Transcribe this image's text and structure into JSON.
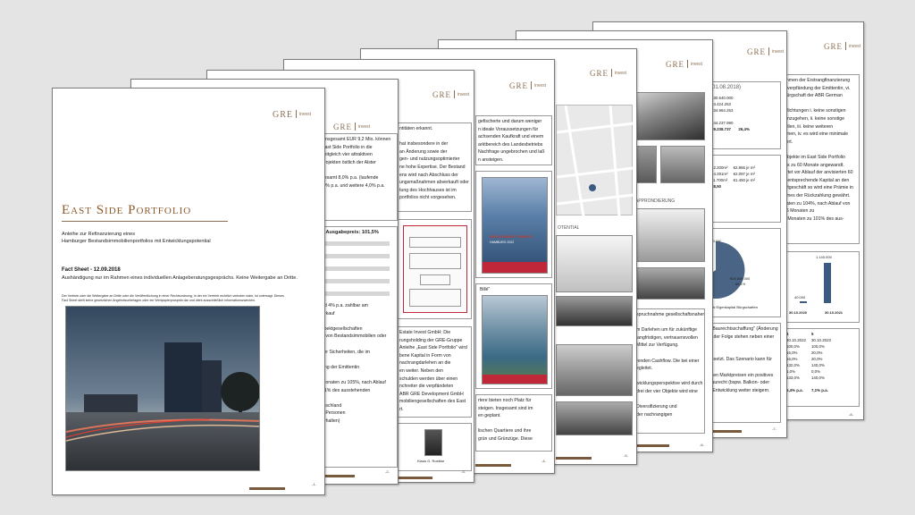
{
  "logo": {
    "brand": "GRE",
    "suffix": "invest"
  },
  "cover": {
    "title": "East Side Portfolio",
    "subtitle_1": "Anleihe zur Refinanzierung eines",
    "subtitle_2": "Hamburger Bestandsimmobilienportfolios mit Entwicklungspotential",
    "factsheet": "Fact Sheet - 12.09.2018",
    "notice": "Aushändigung nur im Rahmen eines individuellen Anlageberatungsgesprächs. Keine Weitergabe an Dritte.",
    "disclaimer_1": "Der Vertrieb oder die Weitergabe an Dritte oder die Veröffentlichung in einer Rechtsordnung, in der ein Vertrieb rechtlich verboten wäre, ist untersagt. Dieses",
    "disclaimer_2": "Fact Sheet stellt keine gesetzlichen Angebotsunterlagen oder ein Wertpapierprospekt dar und dient ausschließlich Informationszwecken.",
    "page_no": "-1-"
  },
  "page2": {
    "lines": [
      "t insgesamt EUR 9,2 Mio. können",
      "East Side Portfolio in die",
      "zeitgleich vier attraktiven",
      "projekten östlich der Alster",
      "",
      "gesamt 8,0% p.a. (laufende",
      ",0% p.a. und weitere 4,0% p.a."
    ],
    "heading": "l, Ausgabepreis: 101,5%",
    "lines2": [
      "nd 4% p.a. zahlbar am",
      "erkauf",
      "",
      "spektgesellschaften",
      "n von Bestandsimmobilien oder",
      "",
      "ller Sicherheiten, die im",
      "",
      "ung der Emittentin",
      "",
      "Monaten zu 105%, nach Ablauf",
      "01% des ausstehenden",
      "",
      "utschland",
      "h Personen",
      "erhalten)"
    ],
    "page_no": "-2-"
  },
  "page3": {
    "lines": [
      "ntitäten erkannt.",
      "",
      "hat insbesondere in der",
      "an Änderung sowie der",
      "gen- und nutzungsoptimierter",
      "ne hohe Expertise. Der Bestand",
      "ens wird nach Abschluss der",
      "ungsmaßnahmen abverkauft oder",
      "tung des Hochhauses ist im",
      "portfolios nicht vorgesehen."
    ],
    "lines2": [
      "Estate Invest GmbH: Die",
      "rungsholding der GRE-Gruppe",
      "Anleihe „East Side Portfolio\" wird",
      "bene Kapital in Form von",
      "nachrangdarlehen an die",
      "en weiter. Neben den",
      "schulden werden über einen",
      "nchreiter die verpfändeten",
      "ABR GRE Development GmbH",
      "mobiliengesellschaften des East",
      "rt."
    ],
    "person": "Klaus G. Roebke",
    "page_no": "-3-"
  },
  "page4": {
    "lines": [
      "gefischerte und darum weniger",
      "n ideale Voraussetzungen für",
      "achsenden Kaufkraft und einem",
      "arktbereich des Landesbetriebs",
      "Nachfrage ungebrochen und laß",
      "n ansteigen."
    ],
    "brochure_top": "BRÜCKENBÜRO TRIEBSTR.",
    "brochure_city": "HAMBURG 2022",
    "mid_label": "Billé\"",
    "lines2": [
      "rtere bieten noch Platz für",
      "steigen. Insgesamt sind im",
      "en geplant.",
      "",
      "lischen Quartiere und ihre",
      "grün und Grünzüge. Diese"
    ],
    "page_no": "-4-"
  },
  "page5": {
    "label": "OTENTIAL",
    "page_no": "-5-"
  },
  "page6": {
    "label": "APPRONDIERUNG",
    "lines": [
      "spruchnahme gesellschaftsnaher",
      "",
      "m Darlehen um für zukünftige",
      "langfristigen, vertrauensvollen",
      "Mittel zur Verfügung.",
      "",
      "fenden Cashflow. Die bei einer",
      "egleitet.",
      "",
      "wicklungsperspektive wird durch",
      "drei der vier Objekte wird eine",
      "",
      "Diversifizierung und",
      "der nachrangigen"
    ],
    "page_no": "-6-"
  },
  "page7": {
    "header": "(01.08.2018)",
    "rows": [
      [
        "€30.540.000",
        ""
      ],
      [
        "€4.424.253",
        ""
      ],
      [
        "€34.964.253",
        ""
      ],
      [
        "",
        ""
      ],
      [
        "€44.237.990",
        ""
      ],
      [
        "€9.238.737",
        "26,4%"
      ]
    ],
    "rows2": [
      [
        "12.200m²",
        "€2.866 je m²"
      ],
      [
        "14.291m²",
        "€2.097 je m²"
      ],
      [
        "11.700m²",
        "€1.450 je m²"
      ],
      [
        "€8,50",
        ""
      ]
    ],
    "pie_label_1": "293.000",
    "pie_label_2": "€25.605.000",
    "pie_pct": "68,1%",
    "legend": "nital   Eigenkapital   Bürgschaften",
    "lines": [
      "e Baurechtsschaffung\" (Änderung",
      "in der Folge stehen neben einer",
      "",
      "",
      "gesetzt. Das Szenario kann für",
      "",
      "ellen Marktpreisen ein positives",
      "Baurecht (bspw. Balkon- oder",
      "e Entwicklung weiter steigern."
    ],
    "page_no": "-7-"
  },
  "page8": {
    "lines": [
      "ahmen der Erstrangfinanzierung",
      "tsverpfändung der Emittentin, vi.",
      "Bürgschaft der ABR German",
      "",
      "pflichtungen i. keine sonstigen",
      "einzugehen, ii. keine sonstige",
      "tellen, iii. keine weiteren",
      "hmen, iv. es wird eine minimale",
      "sert.",
      "",
      "Objekte im East Side Portfolio",
      "bis zu 60 Monate angewandt.",
      "artet vor Ablauf der anvisierten 60",
      "n entsprechende Kapital an den",
      "aftgeschäft so wird eine Prämie in",
      "hmes der Rückzahlung gewährt.",
      "naten zu 104%, nach Ablauf von",
      "36 Monaten zu",
      "8 Monaten zu 101% des aus-"
    ],
    "bar_value": "1.140.000",
    "bar_value_2": "40.000",
    "dates": [
      "30.10.2020",
      "30.10.2021"
    ],
    "table_head": [
      "4",
      "5"
    ],
    "table_rows": [
      [
        "30.10.2022",
        "30.10.2023"
      ],
      [
        "100,0%",
        "100,0%"
      ],
      [
        "16,0%",
        "20,0%"
      ],
      [
        "16,0%",
        "20,0%"
      ],
      [
        "132,0%",
        "140,0%"
      ],
      [
        "1,0%",
        "0,0%"
      ],
      [
        "133,0%",
        "140,0%"
      ],
      [
        "",
        ""
      ],
      [
        "6,4% p.a.",
        "7,1% p.a."
      ]
    ],
    "page_no": "-8-"
  }
}
